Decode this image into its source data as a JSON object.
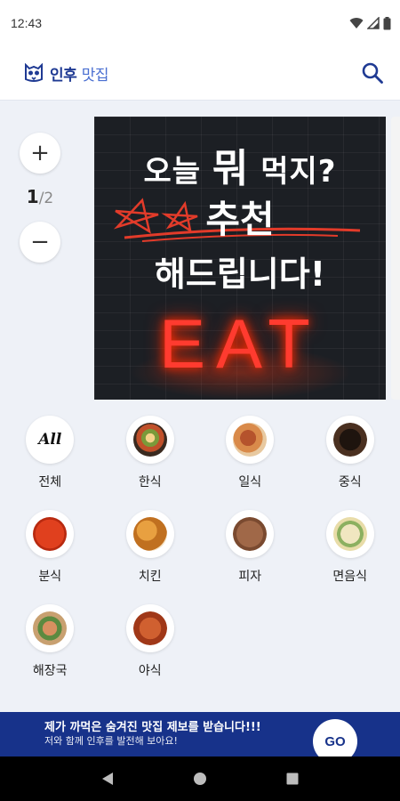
{
  "status_bar": {
    "time": "12:43",
    "icons": [
      "wifi-icon",
      "signal-icon",
      "battery-icon"
    ]
  },
  "header": {
    "logo_icon": "owl-logo-icon",
    "logo_main": "인후",
    "logo_sub": "맛집",
    "search_icon": "search-icon",
    "brand_color": "#1f3a93"
  },
  "pager": {
    "plus": "+",
    "current": "1",
    "total": "/2",
    "minus": "−"
  },
  "banner": {
    "line1_a": "오늘",
    "line1_b": "뭐",
    "line1_c": "먹지?",
    "line2": "추천",
    "line3": "해드립니다!",
    "neon": "EAT"
  },
  "categories": [
    {
      "label": "전체",
      "thumb": "All"
    },
    {
      "label": "한식",
      "thumb": ""
    },
    {
      "label": "일식",
      "thumb": ""
    },
    {
      "label": "중식",
      "thumb": ""
    },
    {
      "label": "분식",
      "thumb": ""
    },
    {
      "label": "치킨",
      "thumb": ""
    },
    {
      "label": "피자",
      "thumb": ""
    },
    {
      "label": "면음식",
      "thumb": ""
    },
    {
      "label": "해장국",
      "thumb": ""
    },
    {
      "label": "야식",
      "thumb": ""
    }
  ],
  "promo": {
    "title": "제가 까먹은 숨겨진 맛집 제보를 받습니다!!!",
    "subtitle": "저와 함께 인후를 발전해 보아요!",
    "go": "GO",
    "bg_color": "#17328a"
  },
  "nav": {
    "back_icon": "back-triangle-icon",
    "home_icon": "home-circle-icon",
    "recents_icon": "recents-square-icon"
  }
}
